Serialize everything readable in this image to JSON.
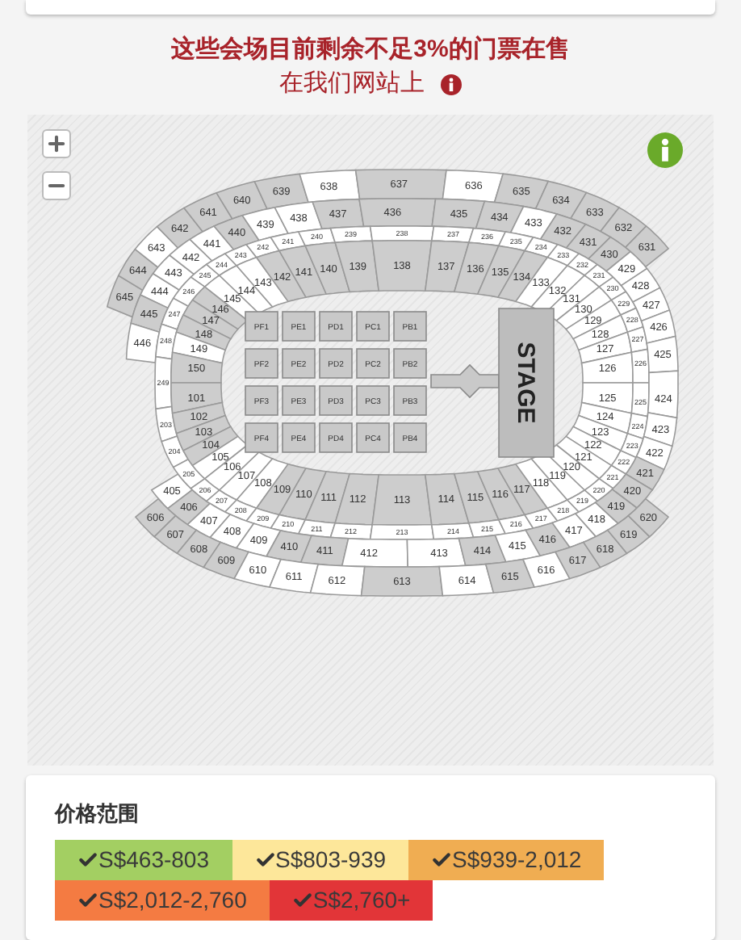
{
  "notice": {
    "title": "这些会场目前剩余不足3%的门票在售",
    "subtitle": "在我们网站上"
  },
  "map": {
    "stage": "STAGE",
    "sides": [
      {
        "kind": "north",
        "arcs": [
          {
            "kind": "top",
            "sections": [
              {
                "label": "645",
                "available": true
              },
              {
                "label": "644",
                "available": true
              },
              {
                "label": "643",
                "available": false
              },
              {
                "label": "642",
                "available": true
              },
              {
                "label": "641",
                "available": true
              },
              {
                "label": "640",
                "available": true
              },
              {
                "label": "639",
                "available": true
              },
              {
                "label": "638",
                "available": false
              },
              {
                "label": "637",
                "available": true
              },
              {
                "label": "636",
                "available": false
              },
              {
                "label": "635",
                "available": true
              },
              {
                "label": "634",
                "available": true
              },
              {
                "label": "633",
                "available": true
              },
              {
                "label": "632",
                "available": true
              },
              {
                "label": "631",
                "available": true
              }
            ]
          },
          {
            "kind": "upper",
            "sections": [
              {
                "label": "444",
                "available": false
              },
              {
                "label": "443",
                "available": false
              },
              {
                "label": "442",
                "available": false
              },
              {
                "label": "441",
                "available": false
              },
              {
                "label": "440",
                "available": true
              },
              {
                "label": "439",
                "available": false
              },
              {
                "label": "438",
                "available": false
              },
              {
                "label": "437",
                "available": true
              },
              {
                "label": "436",
                "available": true
              },
              {
                "label": "435",
                "available": true
              },
              {
                "label": "434",
                "available": true
              },
              {
                "label": "433",
                "available": false
              },
              {
                "label": "432",
                "available": true
              },
              {
                "label": "431",
                "available": true
              }
            ]
          },
          {
            "kind": "box",
            "sections": [
              {
                "label": "245",
                "available": false
              },
              {
                "label": "244",
                "available": false
              },
              {
                "label": "243",
                "available": false
              },
              {
                "label": "242",
                "available": false
              },
              {
                "label": "241",
                "available": false
              },
              {
                "label": "240",
                "available": false
              },
              {
                "label": "239",
                "available": false
              },
              {
                "label": "238",
                "available": false
              },
              {
                "label": "237",
                "available": false
              },
              {
                "label": "236",
                "available": false
              },
              {
                "label": "235",
                "available": false
              },
              {
                "label": "234",
                "available": false
              },
              {
                "label": "233",
                "available": false
              },
              {
                "label": "232",
                "available": false
              }
            ]
          },
          {
            "kind": "lower",
            "sections": [
              {
                "label": "145",
                "available": false
              },
              {
                "label": "144",
                "available": false
              },
              {
                "label": "143",
                "available": false
              },
              {
                "label": "142",
                "available": true
              },
              {
                "label": "141",
                "available": true
              },
              {
                "label": "140",
                "available": true
              },
              {
                "label": "139",
                "available": true
              },
              {
                "label": "138",
                "available": true
              },
              {
                "label": "137",
                "available": true
              },
              {
                "label": "136",
                "available": true
              },
              {
                "label": "135",
                "available": true
              },
              {
                "label": "134",
                "available": true
              },
              {
                "label": "133",
                "available": false
              },
              {
                "label": "132",
                "available": false
              }
            ]
          }
        ]
      },
      {
        "kind": "west",
        "arcs": [
          {
            "kind": "upper",
            "sections": [
              {
                "label": "445",
                "available": true
              },
              {
                "label": "446",
                "available": false
              },
              {
                "label": "405",
                "available": false
              },
              {
                "label": "406",
                "available": true
              }
            ]
          },
          {
            "kind": "box",
            "sections": [
              {
                "label": "246",
                "available": false
              },
              {
                "label": "247",
                "available": false
              },
              {
                "label": "248",
                "available": false
              },
              {
                "label": "249",
                "available": false
              },
              {
                "label": "203",
                "available": false
              },
              {
                "label": "204",
                "available": false
              },
              {
                "label": "205",
                "available": false
              }
            ]
          },
          {
            "kind": "lower",
            "sections": [
              {
                "label": "146",
                "available": true
              },
              {
                "label": "147",
                "available": true
              },
              {
                "label": "148",
                "available": true
              },
              {
                "label": "149",
                "available": false
              },
              {
                "label": "150",
                "available": true
              },
              {
                "label": "101",
                "available": true
              },
              {
                "label": "102",
                "available": true
              },
              {
                "label": "103",
                "available": true
              },
              {
                "label": "104",
                "available": true
              },
              {
                "label": "105",
                "available": false
              }
            ]
          }
        ]
      },
      {
        "kind": "east",
        "arcs": [
          {
            "kind": "lower",
            "sections": [
              {
                "label": "131",
                "available": false
              },
              {
                "label": "130",
                "available": false
              },
              {
                "label": "129",
                "available": false
              },
              {
                "label": "128",
                "available": false
              },
              {
                "label": "127",
                "available": false
              },
              {
                "label": "126",
                "available": false
              },
              {
                "label": "125",
                "available": false
              },
              {
                "label": "124",
                "available": false
              },
              {
                "label": "123",
                "available": false
              },
              {
                "label": "122",
                "available": false
              },
              {
                "label": "121",
                "available": false
              },
              {
                "label": "120",
                "available": false
              }
            ]
          },
          {
            "kind": "box",
            "sections": [
              {
                "label": "231",
                "available": false
              },
              {
                "label": "230",
                "available": false
              },
              {
                "label": "229",
                "available": false
              },
              {
                "label": "228",
                "available": false
              },
              {
                "label": "227",
                "available": false
              },
              {
                "label": "226",
                "available": false
              },
              {
                "label": "225",
                "available": false
              },
              {
                "label": "224",
                "available": false
              },
              {
                "label": "223",
                "available": false
              },
              {
                "label": "222",
                "available": false
              },
              {
                "label": "221",
                "available": false
              },
              {
                "label": "220",
                "available": false
              }
            ]
          },
          {
            "kind": "upper",
            "sections": [
              {
                "label": "430",
                "available": true
              },
              {
                "label": "429",
                "available": false
              },
              {
                "label": "428",
                "available": false
              },
              {
                "label": "427",
                "available": false
              },
              {
                "label": "426",
                "available": false
              },
              {
                "label": "425",
                "available": false
              },
              {
                "label": "424",
                "available": false
              },
              {
                "label": "423",
                "available": false
              },
              {
                "label": "422",
                "available": false
              },
              {
                "label": "421",
                "available": true
              }
            ]
          }
        ]
      },
      {
        "kind": "south",
        "arcs": [
          {
            "kind": "lower",
            "sections": [
              {
                "label": "106",
                "available": false
              },
              {
                "label": "107",
                "available": false
              },
              {
                "label": "108",
                "available": false
              },
              {
                "label": "109",
                "available": true
              },
              {
                "label": "110",
                "available": true
              },
              {
                "label": "111",
                "available": true
              },
              {
                "label": "112",
                "available": true
              },
              {
                "label": "113",
                "available": true
              },
              {
                "label": "114",
                "available": true
              },
              {
                "label": "115",
                "available": true
              },
              {
                "label": "116",
                "available": true
              },
              {
                "label": "117",
                "available": true
              },
              {
                "label": "118",
                "available": false
              },
              {
                "label": "119",
                "available": false
              }
            ]
          },
          {
            "kind": "box",
            "sections": [
              {
                "label": "206",
                "available": false
              },
              {
                "label": "207",
                "available": false
              },
              {
                "label": "208",
                "available": false
              },
              {
                "label": "209",
                "available": false
              },
              {
                "label": "210",
                "available": false
              },
              {
                "label": "211",
                "available": false
              },
              {
                "label": "212",
                "available": false
              },
              {
                "label": "213",
                "available": false
              },
              {
                "label": "214",
                "available": false
              },
              {
                "label": "215",
                "available": false
              },
              {
                "label": "216",
                "available": false
              },
              {
                "label": "217",
                "available": false
              },
              {
                "label": "218",
                "available": false
              },
              {
                "label": "219",
                "available": false
              }
            ]
          },
          {
            "kind": "upper",
            "sections": [
              {
                "label": "407",
                "available": false
              },
              {
                "label": "408",
                "available": false
              },
              {
                "label": "409",
                "available": false
              },
              {
                "label": "410",
                "available": true
              },
              {
                "label": "411",
                "available": true
              },
              {
                "label": "412",
                "available": false
              },
              {
                "label": "413",
                "available": false
              },
              {
                "label": "414",
                "available": true
              },
              {
                "label": "415",
                "available": false
              },
              {
                "label": "416",
                "available": true
              },
              {
                "label": "417",
                "available": false
              },
              {
                "label": "418",
                "available": false
              },
              {
                "label": "419",
                "available": true
              },
              {
                "label": "420",
                "available": true
              }
            ]
          },
          {
            "kind": "top",
            "sections": [
              {
                "label": "606",
                "available": true
              },
              {
                "label": "607",
                "available": true
              },
              {
                "label": "608",
                "available": true
              },
              {
                "label": "609",
                "available": true
              },
              {
                "label": "610",
                "available": false
              },
              {
                "label": "611",
                "available": false
              },
              {
                "label": "612",
                "available": false
              },
              {
                "label": "613",
                "available": true
              },
              {
                "label": "614",
                "available": false
              },
              {
                "label": "615",
                "available": true
              },
              {
                "label": "616",
                "available": false
              },
              {
                "label": "617",
                "available": true
              },
              {
                "label": "618",
                "available": true
              },
              {
                "label": "619",
                "available": true
              },
              {
                "label": "620",
                "available": true
              }
            ]
          }
        ]
      }
    ],
    "floor": [
      {
        "label": "PF1"
      },
      {
        "label": "PE1"
      },
      {
        "label": "PD1"
      },
      {
        "label": "PC1"
      },
      {
        "label": "PB1"
      },
      {
        "label": "PF2"
      },
      {
        "label": "PE2"
      },
      {
        "label": "PD2"
      },
      {
        "label": "PC2"
      },
      {
        "label": "PB2"
      },
      {
        "label": "PF3"
      },
      {
        "label": "PE3"
      },
      {
        "label": "PD3"
      },
      {
        "label": "PC3"
      },
      {
        "label": "PB3"
      },
      {
        "label": "PF4"
      },
      {
        "label": "PE4"
      },
      {
        "label": "PD4"
      },
      {
        "label": "PC4"
      },
      {
        "label": "PB4"
      }
    ]
  },
  "legend": {
    "title": "价格范围",
    "items": [
      {
        "label": "S$463-803",
        "color": "#a3cf62",
        "checked": true
      },
      {
        "label": "S$803-939",
        "color": "#fde79a",
        "checked": true
      },
      {
        "label": "S$939-2,012",
        "color": "#f0ad52",
        "checked": true
      },
      {
        "label": "S$2,012-2,760",
        "color": "#f47b42",
        "checked": true
      },
      {
        "label": "S$2,760+",
        "color": "#e23538",
        "checked": true
      }
    ]
  }
}
